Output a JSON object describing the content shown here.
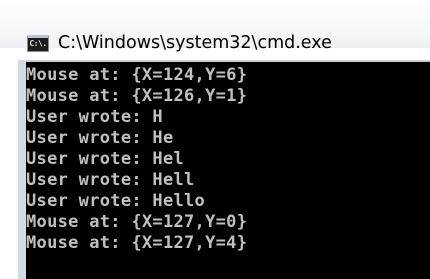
{
  "window": {
    "title": "C:\\Windows\\system32\\cmd.exe",
    "icon": "cmd-console-icon",
    "icon_glyph": "C:\\."
  },
  "console": {
    "text_color": "#c0c0c0",
    "background_color": "#000000",
    "lines": [
      "Mouse at: {X=124,Y=6}",
      "Mouse at: {X=126,Y=1}",
      "User wrote: H",
      "User wrote: He",
      "User wrote: Hel",
      "User wrote: Hell",
      "User wrote: Hello",
      "Mouse at: {X=127,Y=0}",
      "Mouse at: {X=127,Y=4}"
    ]
  }
}
